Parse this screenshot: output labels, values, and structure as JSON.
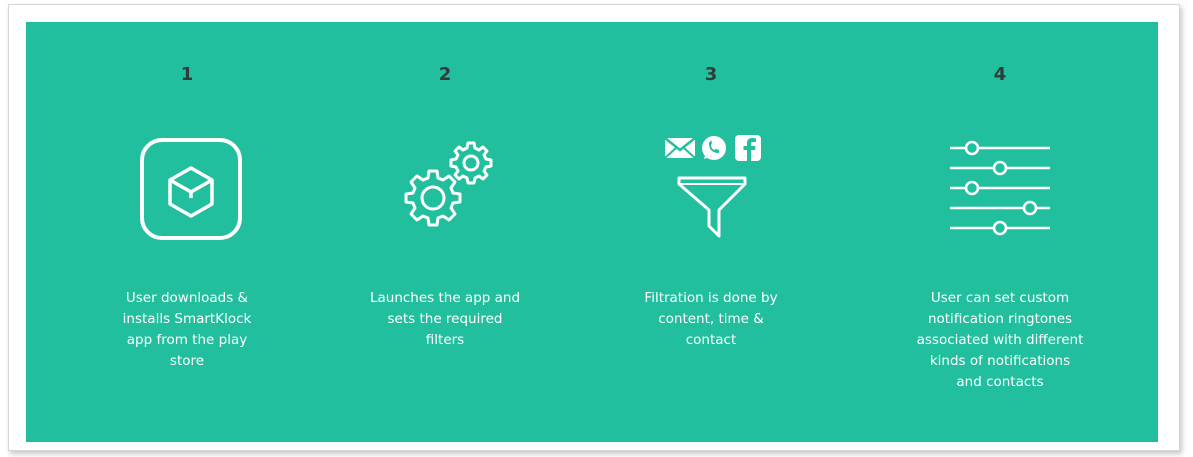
{
  "colors": {
    "panel_background": "#22bf9e",
    "step_number": "#2f3d3a",
    "text_and_icons": "#ffffff"
  },
  "steps": [
    {
      "number": "1",
      "icon": "app-box-icon",
      "description": "User downloads &\ninstalls SmartKlock\napp from the play\nstore"
    },
    {
      "number": "2",
      "icon": "gears-icon",
      "description": "Launches the app and\nsets the required\nfilters"
    },
    {
      "number": "3",
      "icon": "funnel-filter-icon",
      "description": "Filtration is done by\ncontent, time &\ncontact"
    },
    {
      "number": "4",
      "icon": "sliders-icon",
      "description": "User can set custom\nnotification ringtones\nassociated with different\nkinds of notifications\nand contacts"
    }
  ]
}
